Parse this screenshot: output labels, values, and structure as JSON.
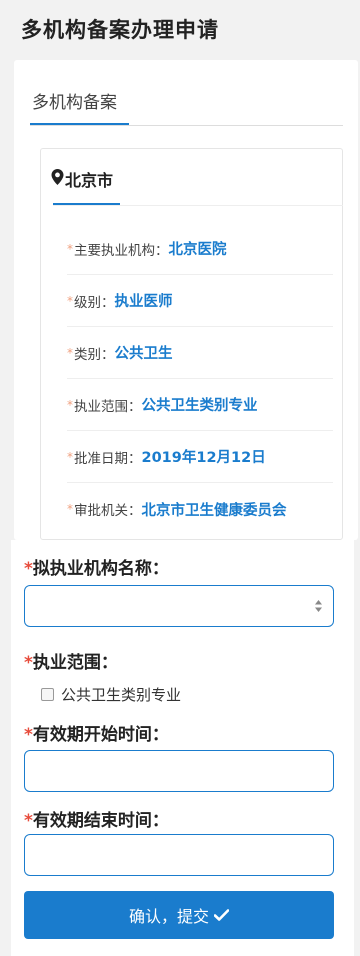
{
  "page": {
    "title": "多机构备案办理申请"
  },
  "tab": {
    "label": "多机构备案"
  },
  "city": {
    "icon": "map-marker-icon",
    "name": "北京市"
  },
  "existing_record": {
    "fields": [
      {
        "label": "主要执业机构：",
        "value": "北京医院"
      },
      {
        "label": "级别：",
        "value": "执业医师"
      },
      {
        "label": "类别：",
        "value": "公共卫生"
      },
      {
        "label": "执业范围：",
        "value": "公共卫生类别专业"
      },
      {
        "label": "批准日期：",
        "value": "2019年12月12日"
      },
      {
        "label": "审批机关：",
        "value": "北京市卫生健康委员会"
      }
    ]
  },
  "form": {
    "required_mark": "*",
    "institution_name": {
      "label": "拟执业机构名称：",
      "value": ""
    },
    "practice_scope": {
      "label": "执业范围：",
      "option": "公共卫生类别专业",
      "checked": false
    },
    "valid_start": {
      "label": "有效期开始时间：",
      "value": ""
    },
    "valid_end": {
      "label": "有效期结束时间：",
      "value": ""
    },
    "submit_label": "确认，提交",
    "submit_icon": "check-icon"
  },
  "colors": {
    "accent": "#1a7ccd",
    "required": "#e74c3c",
    "background": "#f2f2f2"
  }
}
